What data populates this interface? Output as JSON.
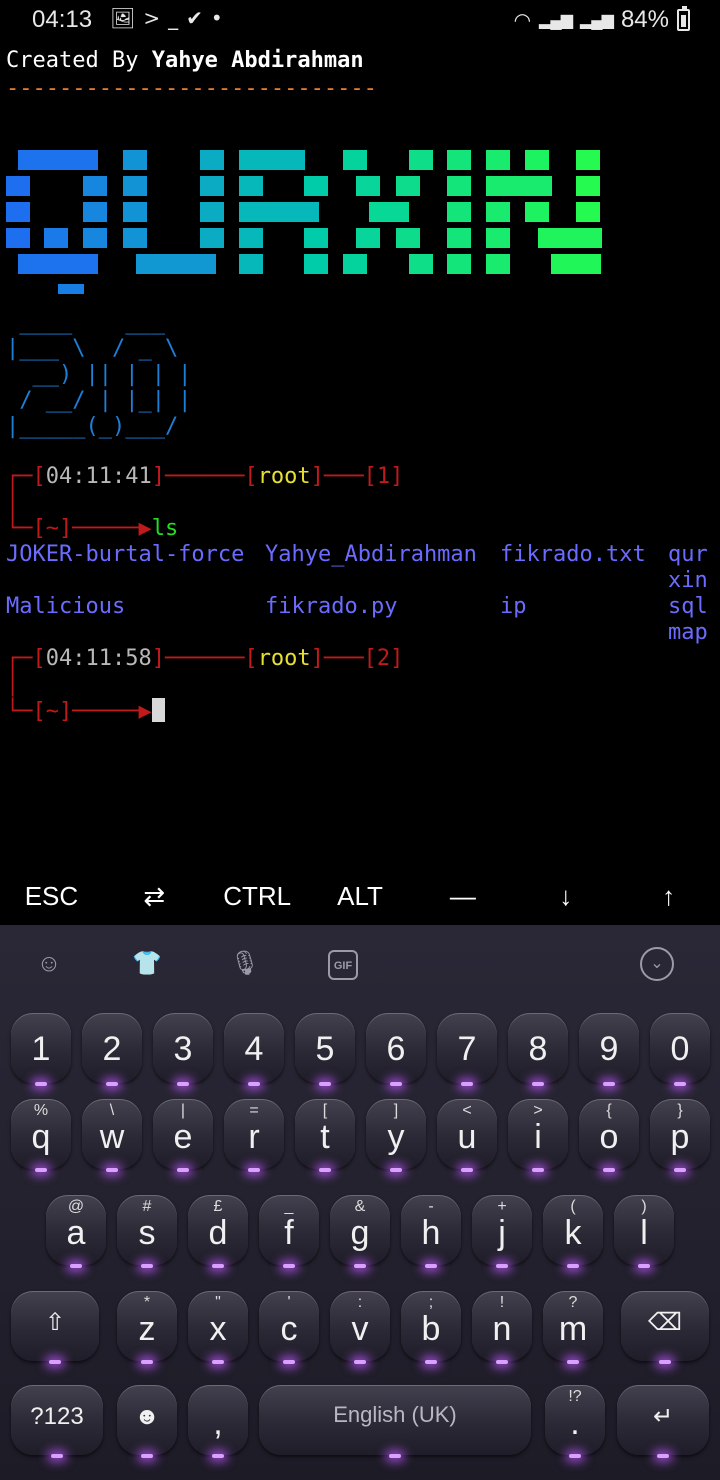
{
  "status_bar": {
    "time": "04:13",
    "battery": "84%",
    "icons": [
      "image-icon",
      "terminal-icon",
      "check-icon",
      "dot-icon",
      "wifi-icon",
      "signal-icon",
      "signal-icon",
      "battery-icon"
    ]
  },
  "terminal": {
    "created_prefix": "Created By ",
    "created_name": "Yahye Abdirahman",
    "dash_line": "----------------------------",
    "logo_text": "QURXIN",
    "ascii_art": " ____    ___  \n|___ \\  / _ \\ \n  __) || | | |\n / __/ | |_| |\n|_____(_)___/ ",
    "prompt1": {
      "time": "04:11:41",
      "user": "root",
      "num": "1",
      "dir": "~",
      "command": "ls"
    },
    "ls_output": {
      "row1": [
        "JOKER-burtal-force",
        "Yahye_Abdirahman",
        "fikrado.txt",
        "qurxin"
      ],
      "row2": [
        "Malicious",
        "fikrado.py",
        "ip",
        "sqlmap"
      ]
    },
    "prompt2": {
      "time": "04:11:58",
      "user": "root",
      "num": "2",
      "dir": "~"
    }
  },
  "extra_keys": [
    "ESC",
    "⇄",
    "CTRL",
    "ALT",
    "—",
    "↓",
    "↑"
  ],
  "keyboard": {
    "toolbar_icons": [
      "emoji-sticker-icon",
      "shirt-icon",
      "mic-icon",
      "gif-icon",
      "chevron-down-icon"
    ],
    "gif_label": "GIF",
    "row_numbers": [
      "1",
      "2",
      "3",
      "4",
      "5",
      "6",
      "7",
      "8",
      "9",
      "0"
    ],
    "row_top": [
      {
        "k": "q",
        "s": "%"
      },
      {
        "k": "w",
        "s": "\\"
      },
      {
        "k": "e",
        "s": "|"
      },
      {
        "k": "r",
        "s": "="
      },
      {
        "k": "t",
        "s": "["
      },
      {
        "k": "y",
        "s": "]"
      },
      {
        "k": "u",
        "s": "<"
      },
      {
        "k": "i",
        "s": ">"
      },
      {
        "k": "o",
        "s": "{"
      },
      {
        "k": "p",
        "s": "}"
      }
    ],
    "row_mid": [
      {
        "k": "a",
        "s": "@"
      },
      {
        "k": "s",
        "s": "#"
      },
      {
        "k": "d",
        "s": "£"
      },
      {
        "k": "f",
        "s": "_"
      },
      {
        "k": "g",
        "s": "&"
      },
      {
        "k": "h",
        "s": "-"
      },
      {
        "k": "j",
        "s": "+"
      },
      {
        "k": "k",
        "s": "("
      },
      {
        "k": "l",
        "s": ")"
      }
    ],
    "row_bottom": [
      {
        "k": "z",
        "s": "*"
      },
      {
        "k": "x",
        "s": "\""
      },
      {
        "k": "c",
        "s": "'"
      },
      {
        "k": "v",
        "s": ":"
      },
      {
        "k": "b",
        "s": ";"
      },
      {
        "k": "n",
        "s": "!"
      },
      {
        "k": "m",
        "s": "?"
      }
    ],
    "shift": "⇧",
    "backspace": "⌫",
    "symbols_label": "?123",
    "emoji": "☻",
    "comma": ",",
    "space_label": "English (UK)",
    "period": ".",
    "period_sub": "!?",
    "enter": "↵"
  }
}
